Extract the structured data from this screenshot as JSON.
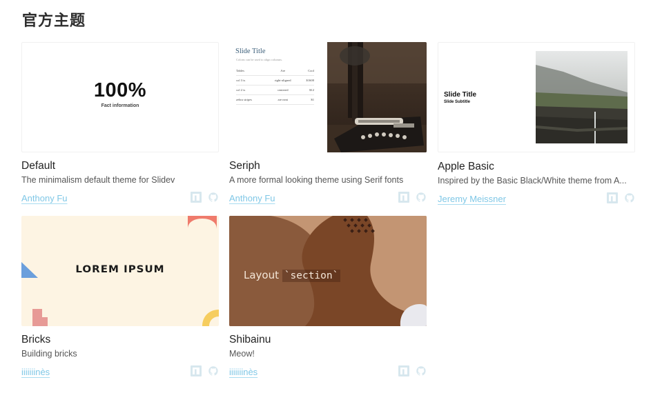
{
  "section": {
    "title": "官方主题"
  },
  "themes": [
    {
      "name": "Default",
      "description": "The minimalism default theme for Slidev",
      "author": "Anthony Fu",
      "preview": {
        "headline": "100%",
        "caption": "Fact information"
      }
    },
    {
      "name": "Seriph",
      "description": "A more formal looking theme using Serif fonts",
      "author": "Anthony Fu",
      "preview": {
        "title": "Slide Title",
        "subtitle": "Colons can be used to align columns.",
        "table": {
          "headers": [
            "Tables",
            "Are",
            "Cool"
          ],
          "rows": [
            [
              "col 3 is",
              "right-aligned",
              "$1600"
            ],
            [
              "col 2 is",
              "centered",
              "$12"
            ],
            [
              "zebra stripes",
              "are neat",
              "$1"
            ]
          ]
        }
      }
    },
    {
      "name": "Apple Basic",
      "description": "Inspired by the Basic Black/White theme from A...",
      "author": "Jeremy Meissner",
      "preview": {
        "title": "Slide Title",
        "subtitle": "Slide Subtitle"
      }
    },
    {
      "name": "Bricks",
      "description": "Building bricks",
      "author": "iiiiiiinès",
      "preview": {
        "headline": "LOREM IPSUM"
      }
    },
    {
      "name": "Shibainu",
      "description": "Meow!",
      "author": "iiiiiiinès",
      "preview": {
        "text": "Layout",
        "code": "`section`"
      }
    }
  ],
  "icons": {
    "npm": "npm-icon",
    "github": "github-icon"
  },
  "colors": {
    "link": "#7fc7e6",
    "icon": "#d7e7ee"
  }
}
